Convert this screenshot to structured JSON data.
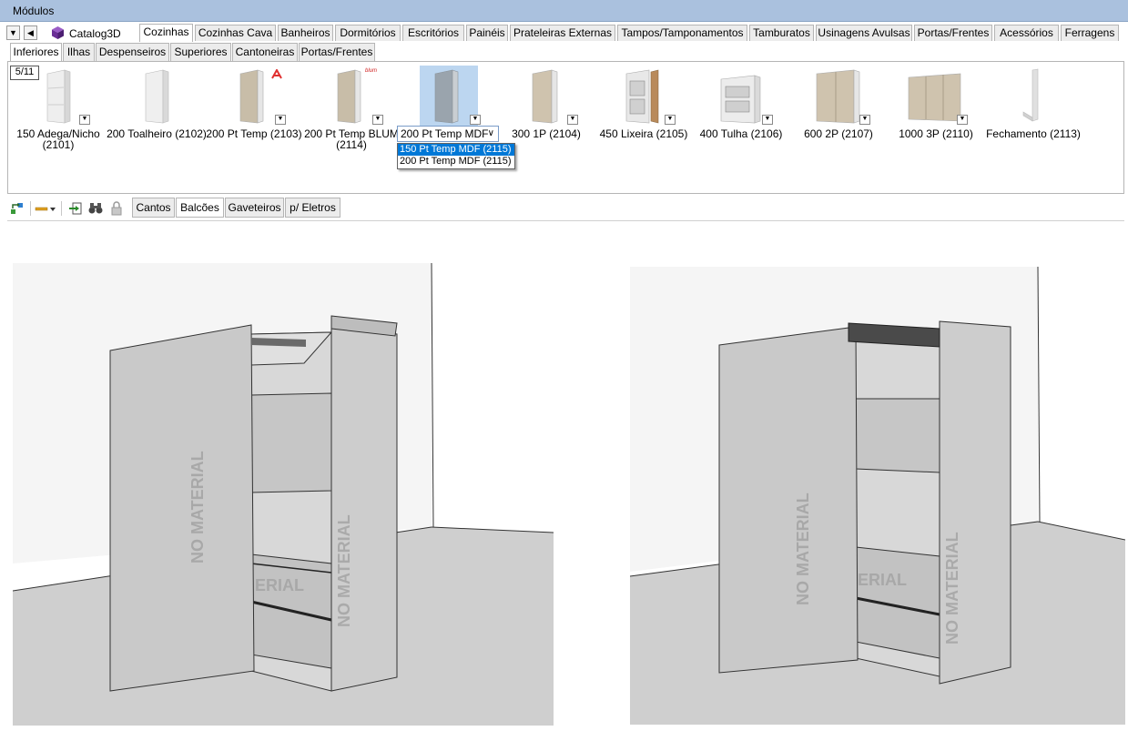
{
  "window": {
    "title": "Módulos"
  },
  "catalog": {
    "label": "Catalog3D",
    "icon": "cube-icon"
  },
  "categories": [
    "Cozinhas",
    "Cozinhas Cava",
    "Banheiros",
    "Dormitórios",
    "Escritórios",
    "Painéis",
    "Prateleiras Externas",
    "Tampos/Tamponamentos",
    "Tamburatos",
    "Usinagens Avulsas",
    "Portas/Frentes",
    "Acessórios",
    "Ferragens"
  ],
  "active_category": "Cozinhas",
  "subcategories": [
    "Inferiores",
    "Ilhas",
    "Despenseiros",
    "Superiores",
    "Cantoneiras",
    "Portas/Frentes"
  ],
  "active_subcategory": "Inferiores",
  "pager": "5/11",
  "modules": [
    {
      "caption": "150 Adega/Nicho (2101)"
    },
    {
      "caption": "200 Toalheiro (2102)"
    },
    {
      "caption": "200 Pt Temp (2103)"
    },
    {
      "caption": "200 Pt Temp BLUM (2114)"
    },
    {
      "caption": ""
    },
    {
      "caption": "300 1P (2104)"
    },
    {
      "caption": "450 Lixeira (2105)"
    },
    {
      "caption": "400 Tulha (2106)"
    },
    {
      "caption": "600 2P (2107)"
    },
    {
      "caption": "1000 3P (2110)"
    },
    {
      "caption": "Fechamento (2113)"
    }
  ],
  "combo": {
    "value": "200 Pt Temp MDF"
  },
  "dropdown_options": [
    "150 Pt Temp MDF (2115)",
    "200 Pt Temp MDF (2115)"
  ],
  "selected_option": "150 Pt Temp MDF (2115)",
  "badges": {
    "blum": "blum"
  },
  "toolbar_tabs": [
    "Cantos",
    "Balcões",
    "Gaveteiros",
    "p/ Eletros"
  ],
  "active_toolbar_tab": "Balcões",
  "viewport_text": "NO MATERIAL",
  "viewport_text_partial": "ERIAL",
  "colors": {
    "titlebar": "#aac1de",
    "selection": "#bcd6f0",
    "dropdown_selected": "#0078d7",
    "cabinet": "#c8c8c8"
  }
}
